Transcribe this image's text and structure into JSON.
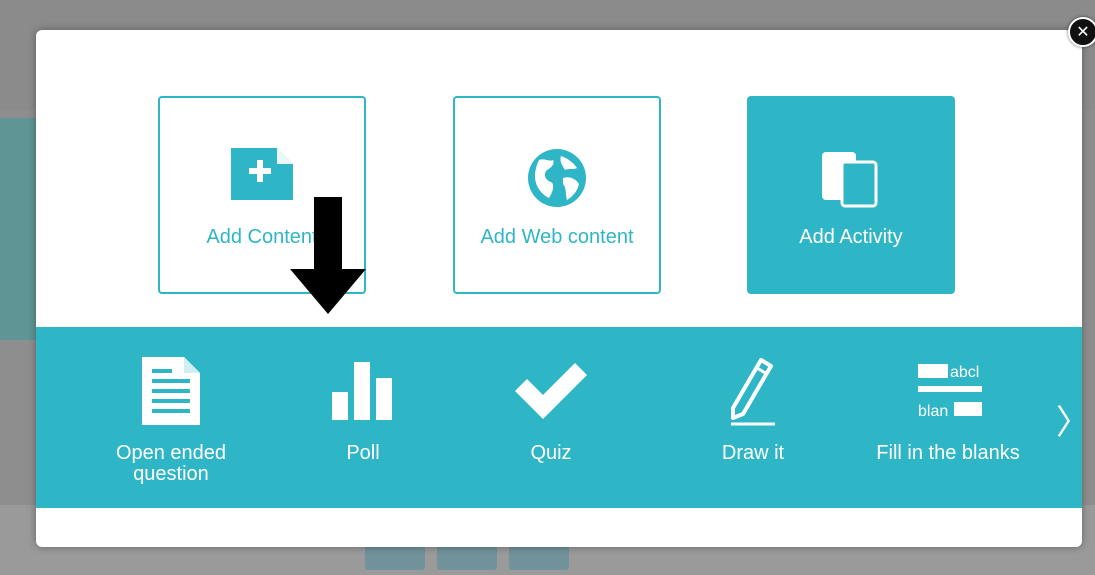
{
  "modal": {
    "close_glyph": "✕",
    "tiles": [
      {
        "label": "Add Content",
        "icon": "add-file-icon"
      },
      {
        "label": "Add Web content",
        "icon": "globe-icon"
      },
      {
        "label": "Add Activity",
        "icon": "copy-pages-icon"
      }
    ],
    "activities": [
      {
        "label": "Open ended question",
        "icon": "document-icon"
      },
      {
        "label": "Poll",
        "icon": "bar-chart-icon"
      },
      {
        "label": "Quiz",
        "icon": "checkmark-icon"
      },
      {
        "label": "Draw it",
        "icon": "pencil-icon"
      },
      {
        "label": "Fill in the blanks",
        "icon": "fill-blanks-icon",
        "icon_text_top": "abcl",
        "icon_text_bottom": "blan"
      }
    ],
    "next_glyph": "〉"
  },
  "colors": {
    "accent": "#2fb6c6",
    "modal_bg": "#ffffff",
    "overlay": "#8e8e8e"
  }
}
